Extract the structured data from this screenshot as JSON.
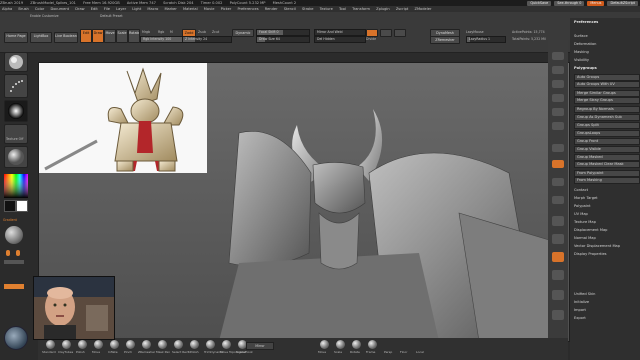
{
  "titlebar": {
    "items": [
      "ZBrush 2019",
      "ZBrushModel_Spikes_101",
      "Free Mem 16.920GB",
      "Active Mem 747",
      "Scratch Disk 204",
      "Timer 0.002",
      "PolyCount 5.232 MP",
      "MeshCount 2"
    ]
  },
  "topright": {
    "quicksave": "QuickSave",
    "seethrough": "See-through 0",
    "menus": "Menus",
    "defaultscript": "DefaultZScript"
  },
  "menubar": {
    "items": [
      "Alpha",
      "Brush",
      "Color",
      "Document",
      "Draw",
      "Edit",
      "File",
      "Layer",
      "Light",
      "Macro",
      "Marker",
      "Material",
      "Movie",
      "Picker",
      "Preferences",
      "Render",
      "Stencil",
      "Stroke",
      "Texture",
      "Tool",
      "Transform",
      "Zplugin",
      "Zscript",
      "ZModeler"
    ]
  },
  "shelf": {
    "home_page": "Home Page",
    "lightbox": "LightBox",
    "live_boolean": "Live Boolean",
    "edit": "Edit",
    "draw": "Draw",
    "move": "Move",
    "scale": "Scale",
    "rotate": "Rotate",
    "mrgb": "Mrgb",
    "rgb": "Rgb",
    "m": "M",
    "rgb_intensity": "Rgb Intensity 100",
    "zadd": "Zadd",
    "zsub": "Zsub",
    "zcut": "Zcut",
    "z_intensity": "Z Intensity 24",
    "focal_shift": "Focal Shift 0",
    "draw_size": "Draw Size 64",
    "dynamic": "Dynamic",
    "active_points": "ActivePoints: 15,774",
    "total_points": "TotalPoints: 5,232 Mil",
    "mirror_weld": "Mirror And Weld",
    "del_hidden": "Del Hidden",
    "divide": "Divide",
    "lazy_mouse": "LazyMouse",
    "lazy_radius": "LazyRadius 1",
    "dynamesh": "DynaMesh",
    "zremesher": "ZRemesher",
    "backface_mask": "BackfaceMask",
    "enable_customize": "Enable Customize",
    "default_preset": "Default Preset"
  },
  "rightpanel": {
    "title": "Preferences",
    "items": [
      "Preferences",
      "Surface",
      "Deformation",
      "Masking",
      "Visibility",
      "Polygroups",
      "Auto Groups",
      "Auto Groups With UV",
      "Merge Similar Groups",
      "Merge Stray Groups",
      "Regroup By Normals",
      "Group As Dynamesh Sub",
      "Groups Split",
      "GroupsLoops",
      "Group Front",
      "Group Visible",
      "Group Masked",
      "Group Masked Clear Mask",
      "From Polypaint",
      "From Masking",
      "Contact",
      "Morph Target",
      "Polypaint",
      "UV Map",
      "Texture Map",
      "Displacement Map",
      "Normal Map",
      "Vector Displacement Map",
      "Display Properties",
      "Unified Skin",
      "Initialize",
      "Import",
      "Export"
    ]
  },
  "leftcol": {
    "color_label": "Gradient",
    "texture_label": "Texture Off",
    "material_label": "Material"
  },
  "bottombar": {
    "items": [
      "Standard",
      "ClayTubes",
      "Polish",
      "Move",
      "Inflate",
      "Pinch",
      "ZRemesher",
      "Mask Pen",
      "Select Rect",
      "hPolish",
      "TrimDynamic",
      "Move Topological",
      "SnakeHook"
    ],
    "center": "Mirror",
    "right": [
      "Move",
      "Scale",
      "Rotate",
      "Frame",
      "Persp",
      "Floor",
      "Local"
    ]
  },
  "colors": {
    "accent": "#d8732a",
    "bg": "#2b2b2b",
    "panel": "#3a3a3a",
    "canvas": "#5a5a5a"
  }
}
